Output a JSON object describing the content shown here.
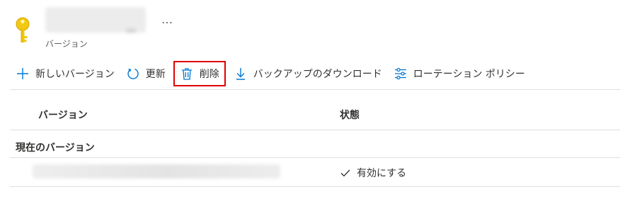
{
  "header": {
    "more_label": "…",
    "subtitle": "バージョン"
  },
  "toolbar": {
    "items": [
      {
        "label": "新しいバージョン",
        "icon": "plus-icon"
      },
      {
        "label": "更新",
        "icon": "refresh-icon"
      },
      {
        "label": "削除",
        "icon": "trash-icon"
      },
      {
        "label": "バックアップのダウンロード",
        "icon": "download-icon"
      },
      {
        "label": "ローテーション ポリシー",
        "icon": "sliders-icon"
      }
    ]
  },
  "table": {
    "columns": [
      "バージョン",
      "状態"
    ],
    "group_label": "現在のバージョン",
    "rows": [
      {
        "version": "",
        "status": "有効にする"
      }
    ]
  },
  "colors": {
    "accent": "#0078d4",
    "key": "#f2c811",
    "highlight": "#e00000"
  }
}
